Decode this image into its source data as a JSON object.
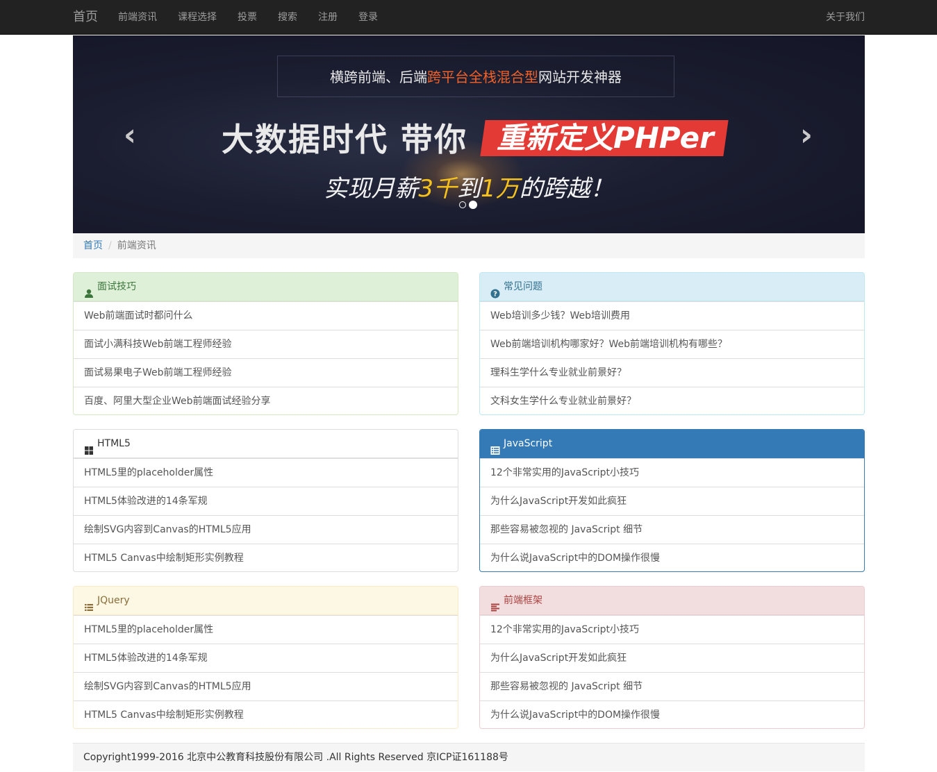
{
  "navbar": {
    "brand": "首页",
    "links": [
      "前端资讯",
      "课程选择",
      "投票",
      "搜索",
      "注册",
      "登录"
    ],
    "right": "关于我们"
  },
  "carousel": {
    "tagline_pre": "横跨前端、后端",
    "tagline_hl": "跨平台全栈混合型",
    "tagline_post": "网站开发神器",
    "headline_white": "大数据时代  带你",
    "headline_red": "重新定义PHPer",
    "sub_a": "实现月薪",
    "sub_b": "3千",
    "sub_c": "到",
    "sub_d": "1万",
    "sub_e": "的跨越！",
    "prev": "‹",
    "next": "›",
    "slide_count": 2,
    "active_slide": 2
  },
  "breadcrumb": {
    "home": "首页",
    "separator": "/",
    "current": "前端资讯"
  },
  "panels": {
    "interview": {
      "title": "面试技巧",
      "icon": "user-icon",
      "items": [
        "Web前端面试时都问什么",
        "面试小满科技Web前端工程师经验",
        "面试易果电子Web前端工程师经验",
        "百度、阿里大型企业Web前端面试经验分享"
      ]
    },
    "faq": {
      "title": "常见问题",
      "icon": "question-circle-icon",
      "items": [
        "Web培训多少钱？Web培训费用",
        "Web前端培训机构哪家好？Web前端培训机构有哪些？",
        "理科生学什么专业就业前景好？",
        "文科女生学什么专业就业前景好？"
      ]
    },
    "html5": {
      "title": "HTML5",
      "icon": "th-large-icon",
      "items": [
        "HTML5里的placeholder属性",
        "HTML5体验改进的14条军规",
        "绘制SVG内容到Canvas的HTML5应用",
        "HTML5 Canvas中绘制矩形实例教程"
      ]
    },
    "javascript": {
      "title": "JavaScript",
      "icon": "list-alt-icon",
      "items": [
        "12个非常实用的JavaScript小技巧",
        "为什么JavaScript开发如此疯狂",
        "那些容易被忽视的 JavaScript 细节",
        "为什么说JavaScript中的DOM操作很慢"
      ]
    },
    "jquery": {
      "title": "JQuery",
      "icon": "list-icon",
      "items": [
        "HTML5里的placeholder属性",
        "HTML5体验改进的14条军规",
        "绘制SVG内容到Canvas的HTML5应用",
        "HTML5 Canvas中绘制矩形实例教程"
      ]
    },
    "frameworks": {
      "title": "前端框架",
      "icon": "align-left-icon",
      "items": [
        "12个非常实用的JavaScript小技巧",
        "为什么JavaScript开发如此疯狂",
        "那些容易被忽视的 JavaScript 细节",
        "为什么说JavaScript中的DOM操作很慢"
      ]
    }
  },
  "footer": {
    "text": "Copyright1999-2016 北京中公教育科技股份有限公司 .All Rights Reserved 京ICP证161188号"
  },
  "colors": {
    "navbar_bg": "#222222",
    "link_blue": "#337ab7",
    "banner_red": "#e43a35",
    "banner_yellow": "#f7c21c",
    "banner_orange": "#f0612a"
  }
}
